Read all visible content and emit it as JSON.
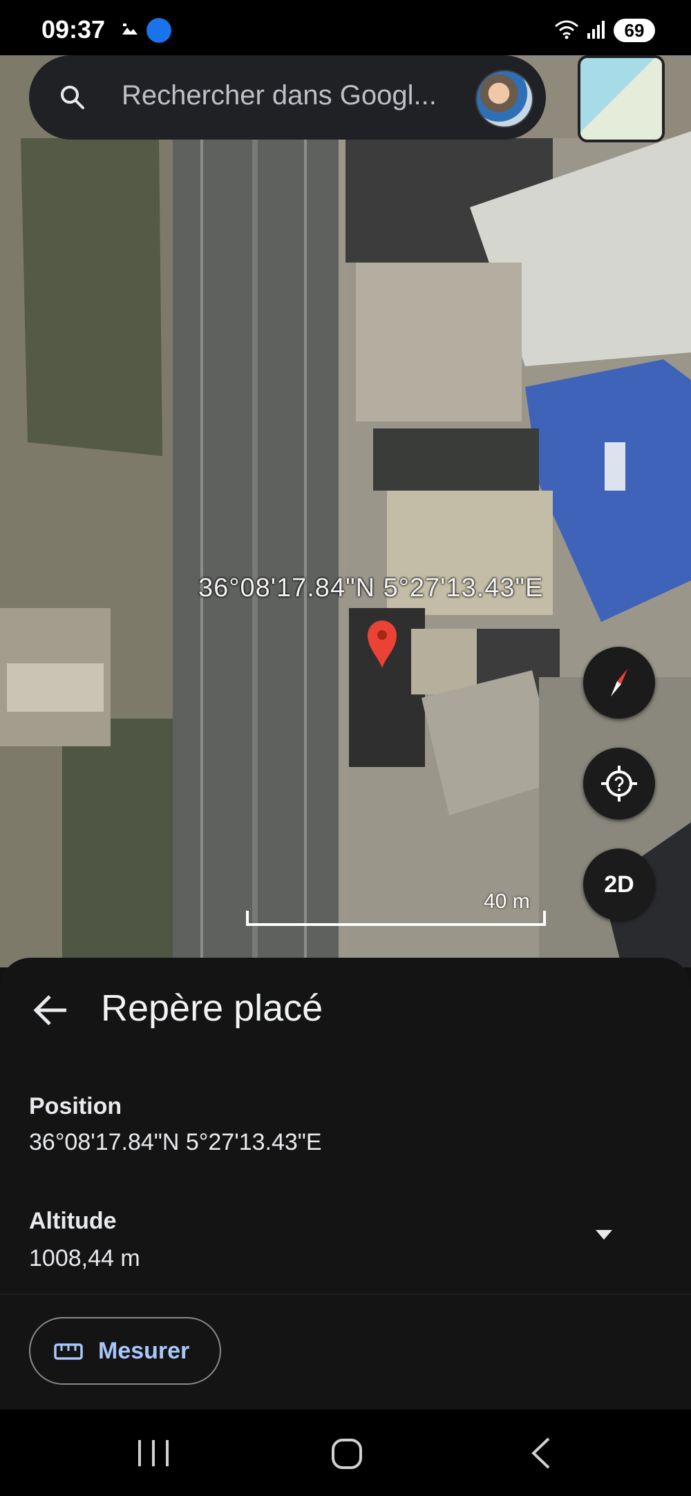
{
  "status_bar": {
    "time": "09:37",
    "battery": "69"
  },
  "search": {
    "placeholder": "Rechercher dans Googl..."
  },
  "map": {
    "coordinates_overlay": "36°08'17.84\"N 5°27'13.43\"E",
    "scale_label": "40 m",
    "view_mode_label": "2D"
  },
  "panel": {
    "title": "Repère placé",
    "position_label": "Position",
    "position_value": "36°08'17.84\"N 5°27'13.43\"E",
    "altitude_label": "Altitude",
    "altitude_value": "1008,44 m",
    "measure_label": "Mesurer"
  },
  "icons": {
    "search": "search-icon",
    "compass": "compass-icon",
    "help_location": "help-location-icon",
    "back": "arrow-left-icon",
    "dropdown": "caret-down-icon",
    "ruler": "ruler-icon",
    "pin": "map-pin-icon"
  },
  "colors": {
    "accent": "#a8c7fa",
    "pin": "#ea4335",
    "sheet_bg": "#141414"
  }
}
